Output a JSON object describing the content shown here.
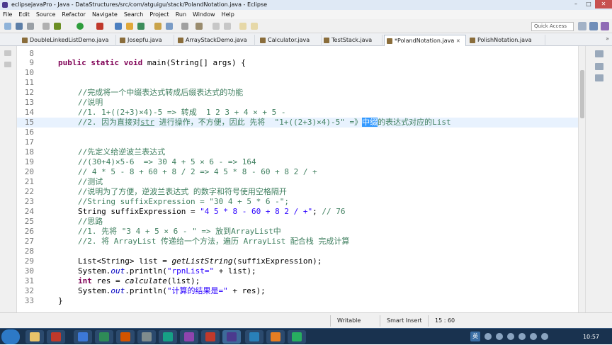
{
  "window": {
    "title": "eclipsejavaPro - Java - DataStructures/src/com/atguigu/stack/PolandNotation.java - Eclipse",
    "minimize": "–",
    "maximize": "□",
    "close": "✕"
  },
  "menu": [
    "File",
    "Edit",
    "Source",
    "Refactor",
    "Navigate",
    "Search",
    "Project",
    "Run",
    "Window",
    "Help"
  ],
  "toolbar": {
    "quick_access_placeholder": "Quick Access"
  },
  "tabs": [
    {
      "label": "DoubleLinkedListDemo.java"
    },
    {
      "label": "Josepfu.java"
    },
    {
      "label": "ArrayStackDemo.java"
    },
    {
      "label": "Calculator.java"
    },
    {
      "label": "TestStack.java"
    },
    {
      "label": "*PolandNotation.java",
      "close": "✕"
    },
    {
      "label": "PolishNotation.java"
    }
  ],
  "tab_overflow": "»",
  "editor": {
    "line_numbers": [
      "8",
      "9",
      "10",
      "11",
      "12",
      "13",
      "14",
      "15",
      "16",
      "17",
      "18",
      "19",
      "20",
      "21",
      "22",
      "23",
      "24",
      "25",
      "26",
      "27",
      "28",
      "29",
      "30",
      "31",
      "32",
      "33"
    ],
    "l9": {
      "k1": "public static void",
      "t1": " main(String[] args) {"
    },
    "l12": "//完成将一个中缀表达式转成后缀表达式的功能",
    "l13": "//说明",
    "l14": "//1. 1+((2+3)×4)-5 => 转成  1 2 3 + 4 × + 5 -",
    "l15": {
      "a": "//2. 因为直接对",
      "b": "str",
      "c": " 进行操作，不方便，因此 先将  \"1+((2+3)×4)-5\" =》",
      "sel": "中缀",
      "d": "的表达式对应的List"
    },
    "l18": "//先定义给逆波兰表达式",
    "l19": "//(30+4)×5-6  => 30 4 + 5 × 6 - => 164",
    "l20": "// 4 * 5 - 8 + 60 + 8 / 2 => 4 5 * 8 - 60 + 8 2 / +",
    "l21": "//测试",
    "l22": "//说明为了方便，逆波兰表达式 的数字和符号使用空格隔开",
    "l23": "//String suffixExpression = \"30 4 + 5 * 6 -\";",
    "l24": {
      "a": "String suffixExpression = ",
      "b": "\"4 5 * 8 - 60 + 8 2 / +\"",
      "c": "; ",
      "d": "// 76"
    },
    "l25": "//思路",
    "l26": "//1. 先将 \"3 4 + 5 × 6 - \" => 放到ArrayList中",
    "l27": "//2. 将 ArrayList 传递给一个方法，遍历 ArrayList 配合栈 完成计算",
    "l29": {
      "a": "List<String> list = ",
      "b": "getListString",
      "c": "(suffixExpression);"
    },
    "l30": {
      "a": "System.",
      "b": "out",
      "c": ".println(",
      "d": "\"rpnList=\"",
      "e": " + list);"
    },
    "l31": {
      "k": "int",
      "a": " res = ",
      "b": "calculate",
      "c": "(list);"
    },
    "l32": {
      "a": "System.",
      "b": "out",
      "c": ".println(",
      "d": "\"计算的结果是=\"",
      "e": " + res);"
    },
    "l33": "}"
  },
  "status": {
    "mode": "Writable",
    "insert": "Smart Insert",
    "position": "15 : 60"
  },
  "taskbar": {
    "time": "10:57",
    "ime": "英"
  },
  "colors": {
    "keyword": "#7f0055",
    "comment": "#3f7f5f",
    "string": "#2a00ff",
    "field": "#0000c0",
    "selection": "#3399ff",
    "current_line": "#e8f2fe"
  }
}
